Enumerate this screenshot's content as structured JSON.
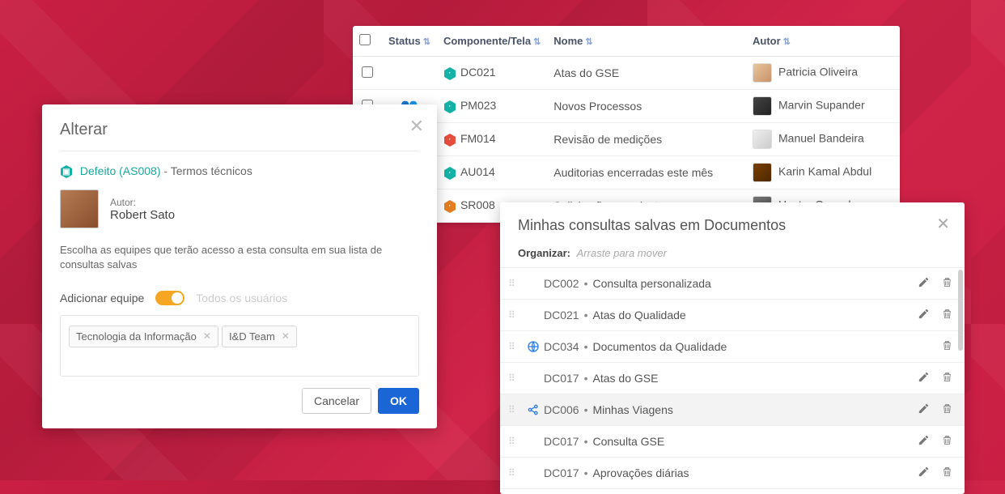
{
  "table": {
    "headers": {
      "status": "Status",
      "componente": "Componente/Tela",
      "nome": "Nome",
      "autor": "Autor"
    },
    "rows": [
      {
        "status": "",
        "hex_color": "#14b2a6",
        "code": "DC021",
        "nome": "Atas do GSE",
        "autor": "Patricia Oliveira",
        "av": "av1"
      },
      {
        "status": "group",
        "hex_color": "#14b2a6",
        "code": "PM023",
        "nome": "Novos Processos",
        "autor": "Marvin Supander",
        "av": "av2"
      },
      {
        "status": "",
        "hex_color": "#e74c3c",
        "code": "FM014",
        "nome": "Revisão de medições",
        "autor": "Manuel Bandeira",
        "av": "av3"
      },
      {
        "status": "",
        "hex_color": "#14b2a6",
        "code": "AU014",
        "nome": "Auditorias encerradas este mês",
        "autor": "Karin Kamal Abdul",
        "av": "av4"
      },
      {
        "status": "",
        "hex_color": "#e67e22",
        "code": "SR008",
        "nome": "Solicitações pendentes",
        "autor": "Hector Gonzales",
        "av": "av5"
      }
    ]
  },
  "dialog": {
    "title": "Alterar",
    "defect_label": "Defeito",
    "defect_code": "(AS008)",
    "defect_name": "Termos técnicos",
    "author_label": "Autor:",
    "author_name": "Robert Sato",
    "description": "Escolha as equipes que terão acesso a esta consulta em sua lista de consultas salvas",
    "add_team_label": "Adicionar equipe",
    "all_users_label": "Todos os usuários",
    "tags": [
      "Tecnologia da Informação",
      "I&D Team"
    ],
    "cancel": "Cancelar",
    "ok": "OK"
  },
  "saved": {
    "title": "Minhas consultas salvas em Documentos",
    "organize_label": "Organizar:",
    "organize_hint": "Arraste para mover",
    "rows": [
      {
        "share": "",
        "code": "DC002",
        "title": "Consulta personalizada",
        "edit": true
      },
      {
        "share": "",
        "code": "DC021",
        "title": "Atas do  Qualidade",
        "edit": true
      },
      {
        "share": "globe",
        "code": "DC034",
        "title": "Documentos da Qualidade",
        "edit": false
      },
      {
        "share": "",
        "code": "DC017",
        "title": "Atas do GSE",
        "edit": true
      },
      {
        "share": "share",
        "code": "DC006",
        "title": "Minhas Viagens",
        "edit": true,
        "active": true
      },
      {
        "share": "",
        "code": "DC017",
        "title": "Consulta GSE",
        "edit": true
      },
      {
        "share": "",
        "code": "DC017",
        "title": "Aprovações diárias",
        "edit": true
      }
    ]
  }
}
